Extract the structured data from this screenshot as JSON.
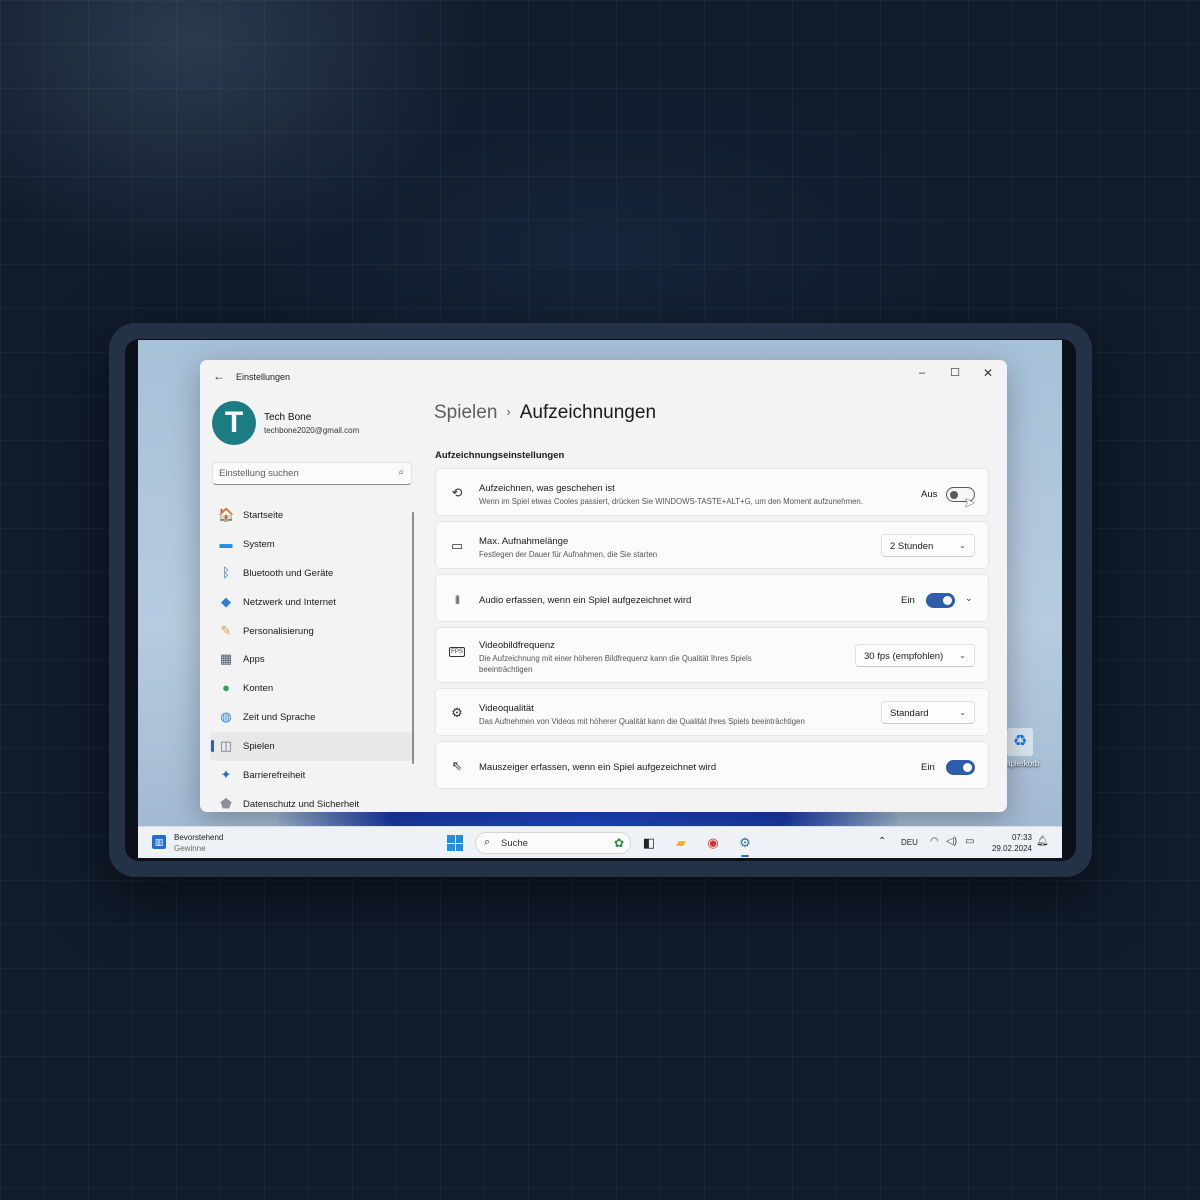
{
  "window": {
    "title": "Einstellungen",
    "back_icon": "arrow-left-icon",
    "minimize": "–",
    "maximize": "☐",
    "close": "✕"
  },
  "profile": {
    "initial": "T",
    "name": "Tech Bone",
    "email": "techbone2020@gmail.com"
  },
  "search": {
    "placeholder": "Einstellung suchen",
    "icon": "search-icon"
  },
  "nav": {
    "items": [
      {
        "label": "Startseite",
        "icon": "home-icon",
        "glyph": "🏠",
        "color": "#e8833a"
      },
      {
        "label": "System",
        "icon": "monitor-icon",
        "glyph": "▬",
        "color": "#1f8fe8"
      },
      {
        "label": "Bluetooth und Geräte",
        "icon": "bluetooth-icon",
        "glyph": "ᛒ",
        "color": "#1f6fd1"
      },
      {
        "label": "Netzwerk und Internet",
        "icon": "wifi-icon",
        "glyph": "◆",
        "color": "#2a7de1"
      },
      {
        "label": "Personalisierung",
        "icon": "brush-icon",
        "glyph": "✎",
        "color": "#e29a3c"
      },
      {
        "label": "Apps",
        "icon": "apps-icon",
        "glyph": "▦",
        "color": "#4d5a70"
      },
      {
        "label": "Konten",
        "icon": "person-icon",
        "glyph": "●",
        "color": "#2aa55e"
      },
      {
        "label": "Zeit und Sprache",
        "icon": "globe-clock-icon",
        "glyph": "◍",
        "color": "#2a7de1"
      },
      {
        "label": "Spielen",
        "icon": "gamepad-icon",
        "glyph": "◫",
        "color": "#6b7a8f"
      },
      {
        "label": "Barrierefreiheit",
        "icon": "accessibility-icon",
        "glyph": "✦",
        "color": "#1f6fd1"
      },
      {
        "label": "Datenschutz und Sicherheit",
        "icon": "shield-icon",
        "glyph": "⬟",
        "color": "#8a8f98"
      }
    ],
    "active_index": 8
  },
  "breadcrumb": {
    "parent": "Spielen",
    "separator": "›",
    "current": "Aufzeichnungen"
  },
  "section": {
    "title": "Aufzeichnungseinstellungen"
  },
  "cards": {
    "record_what_happened": {
      "icon": "record-history-icon",
      "glyph": "⟲",
      "title": "Aufzeichnen, was geschehen ist",
      "desc": "Wenn im Spiel etwas Cooles passiert, drücken Sie WINDOWS-TASTE+ALT+G, um den Moment aufzunehmen.",
      "state": "Aus",
      "on": false
    },
    "max_length": {
      "icon": "video-camera-icon",
      "glyph": "▭",
      "title": "Max. Aufnahmelänge",
      "desc": "Festlegen der Dauer für Aufnahmen, die Sie starten",
      "value": "2 Stunden"
    },
    "audio": {
      "icon": "audio-waveform-icon",
      "glyph": "|||",
      "title": "Audio erfassen, wenn ein Spiel aufgezeichnet wird",
      "state": "Ein",
      "on": true
    },
    "framerate": {
      "icon": "fps-icon",
      "glyph": "FPS",
      "title": "Videobildfrequenz",
      "desc_line1": "Die Aufzeichnung mit einer höheren Bildfrequenz kann die Qualität Ihres Spiels",
      "desc_line2": "beeinträchtigen",
      "value": "30 fps (empfohlen)"
    },
    "quality": {
      "icon": "video-quality-icon",
      "glyph": "⚙",
      "title": "Videoqualität",
      "desc": "Das Aufnehmen von Videos mit höherer Qualität kann die Qualität Ihres Spiels beeinträchtigen",
      "value": "Standard"
    },
    "mouse_cursor": {
      "icon": "mouse-pointer-icon",
      "glyph": "⇖",
      "title": "Mauszeiger erfassen, wenn ein Spiel aufgezeichnet wird",
      "state": "Ein",
      "on": true
    }
  },
  "desktop": {
    "recycle_label": "Papierkorb",
    "recycle_icon": "recycle-bin-icon"
  },
  "taskbar": {
    "widget_title": "Bevorstehend",
    "widget_subtitle": "Gewinne",
    "search_label": "Suche",
    "language": "DEU",
    "time": "07:33",
    "date": "29.02.2024",
    "apps": [
      {
        "icon": "task-view-icon",
        "glyph": "◧",
        "color": "#222"
      },
      {
        "icon": "file-explorer-icon",
        "glyph": "▰",
        "color": "#f2b21b"
      },
      {
        "icon": "chrome-icon",
        "glyph": "◉",
        "color": "#d9342b"
      },
      {
        "icon": "settings-gear-icon",
        "glyph": "⚙",
        "color": "#3a6fb5"
      }
    ]
  }
}
